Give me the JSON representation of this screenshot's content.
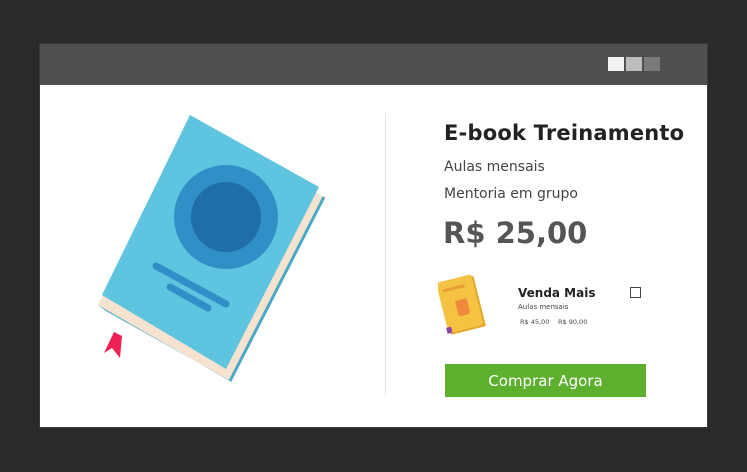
{
  "window": {
    "controls": [
      "window-button-light",
      "window-button-medium",
      "window-button-dark"
    ]
  },
  "product": {
    "title": "E-book Treinamento",
    "features": [
      "Aulas mensais",
      "Mentoria em grupo"
    ],
    "price": "R$ 25,00",
    "image_icon": "book-illustration-icon"
  },
  "upsell": {
    "name": "Venda Mais",
    "description": "Aulas mensais",
    "price": "R$ 45,00",
    "old_price": "R$ 90,00",
    "checked": false,
    "image_icon": "small-book-icon"
  },
  "cta": {
    "label": "Comprar Agora"
  },
  "colors": {
    "background": "#2a2a2a",
    "titlebar": "#4f4f4f",
    "button": "#5db02d",
    "book_cover": "#5ec4df",
    "book_emblem": "#1f7ab1",
    "bookmark": "#ee2255",
    "upsell_cover": "#f5c242"
  }
}
